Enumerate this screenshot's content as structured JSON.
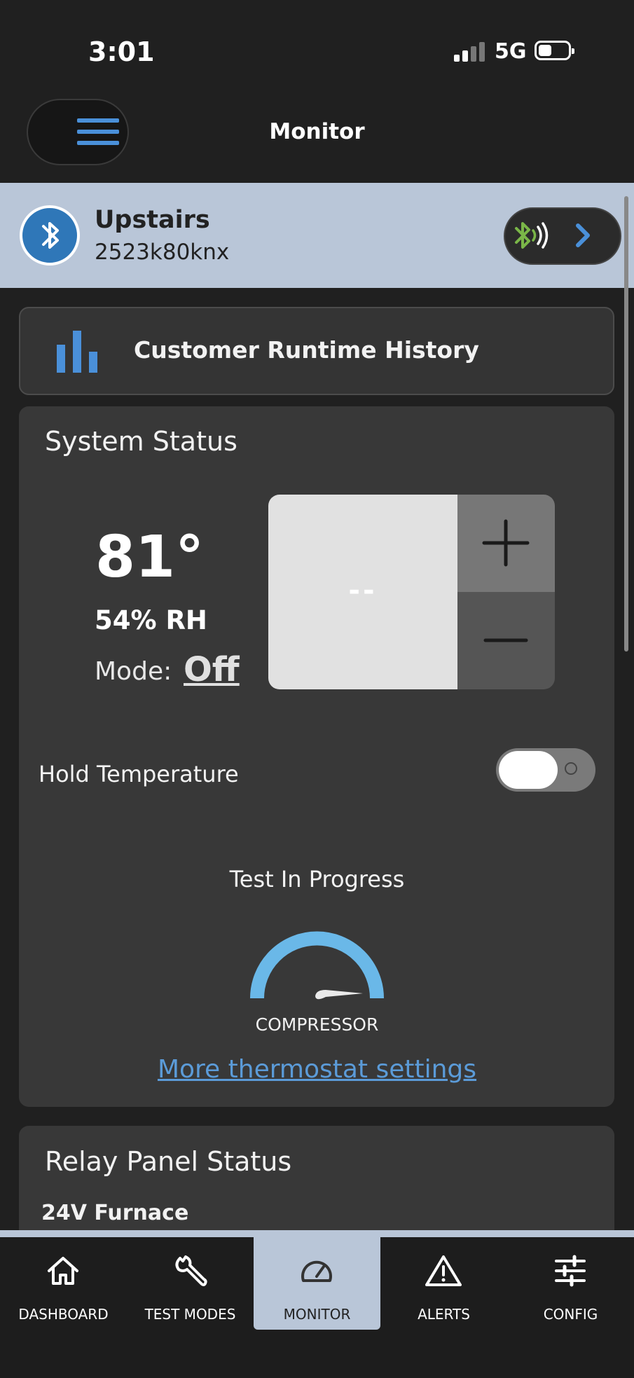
{
  "status_bar": {
    "time": "3:01",
    "network": "5G"
  },
  "header": {
    "title": "Monitor",
    "menu_icon": "hamburger-menu-icon"
  },
  "device": {
    "name": "Upstairs",
    "serial": "2523k80knx",
    "icon": "bluetooth-icon",
    "connection_icon": "bluetooth-connected-icon",
    "accent": "#7ab648"
  },
  "runtime_button": {
    "label": "Customer Runtime History",
    "icon": "bar-chart-icon"
  },
  "system_status": {
    "title": "System Status",
    "temperature": "81°",
    "humidity": "54% RH",
    "mode_label": "Mode:",
    "mode_value": "Off",
    "setpoint": "--",
    "hold_label": "Hold Temperature",
    "hold_on": false,
    "progress_label": "Test In Progress",
    "stage_label": "COMPRESSOR",
    "settings_link": "More thermostat settings"
  },
  "relay_panel": {
    "title": "Relay Panel Status",
    "subtitle": "24V Furnace"
  },
  "bottom_nav": [
    {
      "label": "DASHBOARD",
      "icon": "home-icon",
      "active": false
    },
    {
      "label": "TEST MODES",
      "icon": "wrench-icon",
      "active": false
    },
    {
      "label": "MONITOR",
      "icon": "gauge-icon",
      "active": true
    },
    {
      "label": "ALERTS",
      "icon": "warning-icon",
      "active": false
    },
    {
      "label": "CONFIG",
      "icon": "sliders-icon",
      "active": false
    }
  ],
  "colors": {
    "accent_blue": "#4a90d9",
    "gauge_blue": "#6ab8e8",
    "bar_bg": "#b9c6d8"
  }
}
